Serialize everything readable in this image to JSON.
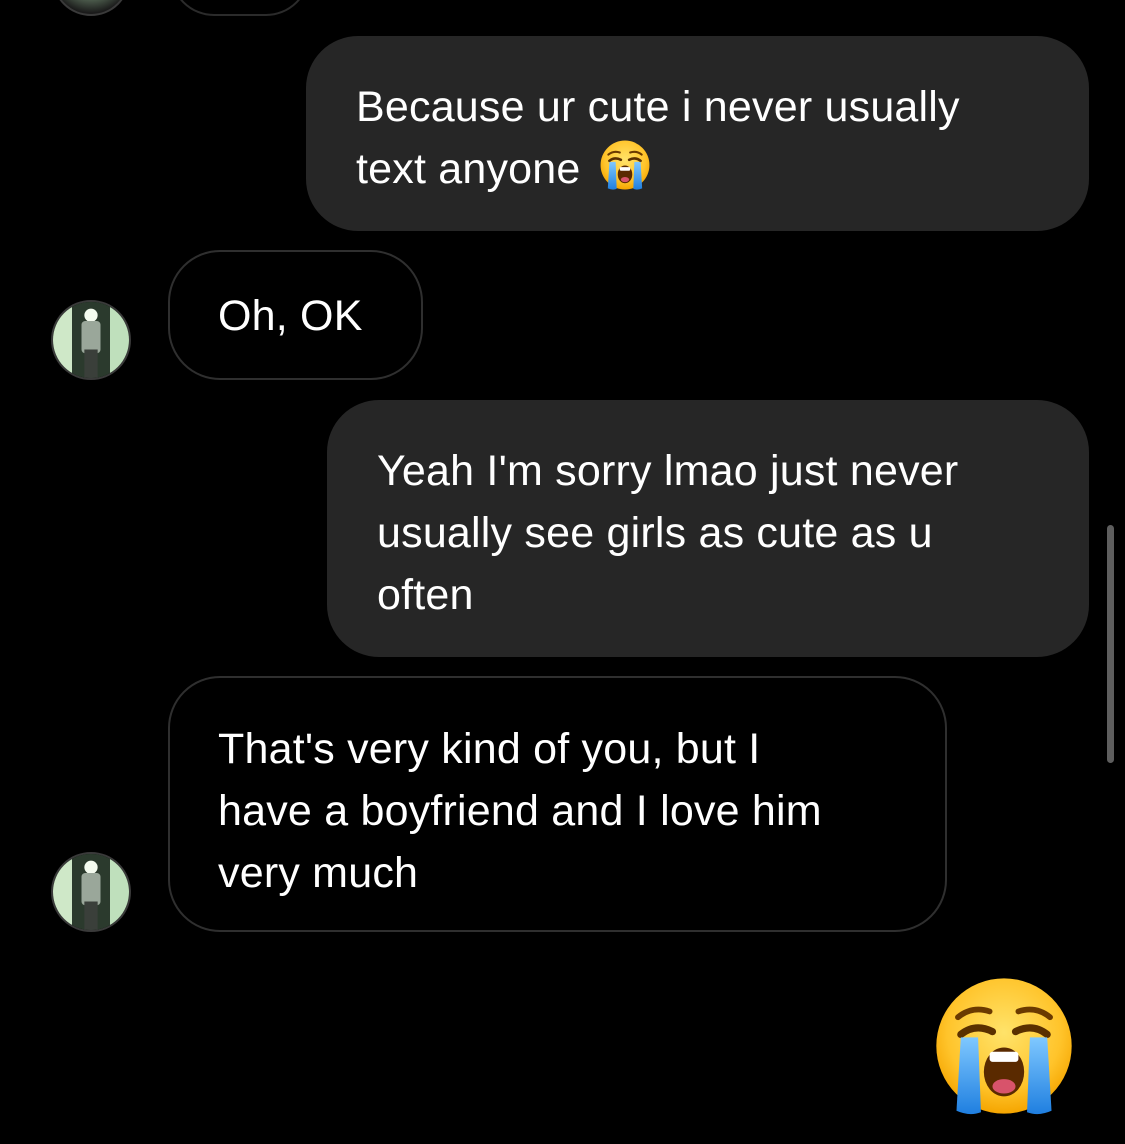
{
  "messages": [
    {
      "direction": "sent",
      "lines": [
        "Because ur cute i never usually",
        "text anyone"
      ],
      "trailing_emoji": "loudly-crying-face"
    },
    {
      "direction": "received",
      "lines": [
        "Oh, OK"
      ]
    },
    {
      "direction": "sent",
      "lines": [
        "Yeah I'm sorry lmao just never",
        "usually see girls as cute as u",
        "often"
      ]
    },
    {
      "direction": "received",
      "lines": [
        "That's very kind of you, but I",
        "have a boyfriend and I love him",
        "very much"
      ]
    }
  ],
  "reaction": {
    "emoji": "loudly-crying-face",
    "direction": "sent"
  },
  "colors": {
    "background": "#000000",
    "sent_bubble": "#262626",
    "received_border": "#2f2f2f",
    "text": "#ffffff",
    "scrollbar": "#5e5e5e"
  }
}
